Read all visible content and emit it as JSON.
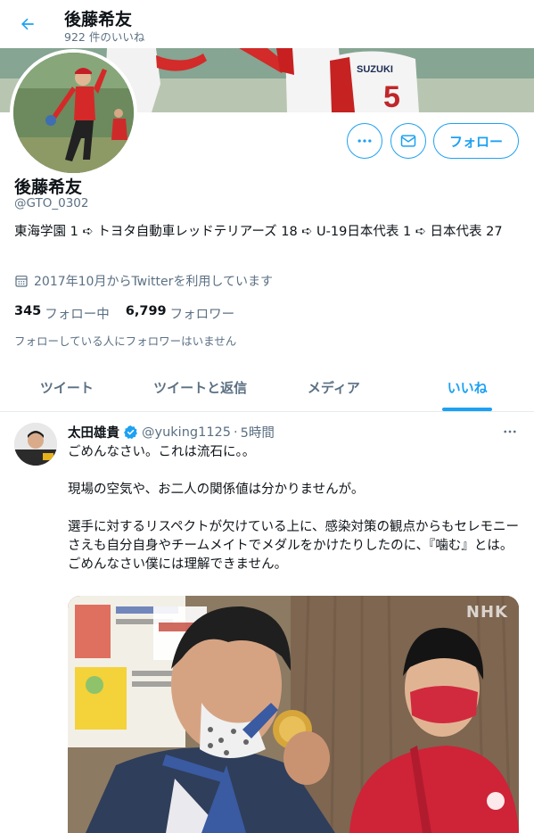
{
  "header": {
    "name": "後藤希友",
    "likes_count": "922 件のいいね",
    "back_icon": "arrow-left-icon"
  },
  "profile": {
    "display_name": "後藤希友",
    "handle": "@GTO_0302",
    "bio": "東海学園 1 ➪ トヨタ自動車レッドテリアーズ 18 ➪ U-19日本代表 1 ➪ 日本代表 27",
    "joined": "2017年10月からTwitterを利用しています",
    "following_count": "345",
    "following_label": "フォロー中",
    "followers_count": "6,799",
    "followers_label": "フォロワー",
    "known_followers": "フォローしている人にフォロワーはいません",
    "banner_jersey_text": "SUZUKI",
    "banner_jersey_number": "5"
  },
  "actions": {
    "more_icon": "ellipsis-icon",
    "message_icon": "envelope-icon",
    "follow_label": "フォロー"
  },
  "tabs": [
    {
      "label": "ツイート",
      "active": false
    },
    {
      "label": "ツイートと返信",
      "active": false
    },
    {
      "label": "メディア",
      "active": false
    },
    {
      "label": "いいね",
      "active": true
    }
  ],
  "tweet": {
    "author": "太田雄貴",
    "handle": "@yuking1125",
    "separator": "·",
    "time": "5時間",
    "lines": [
      "ごめんなさい。これは流石に。。",
      "",
      "現場の空気や、お二人の関係値は分かりませんが。",
      "",
      "選手に対するリスペクトが欠けている上に、感染対策の観点からもセレモニーさえも自分自身やチームメイトでメダルをかけたりしたのに、『噛む』とは。",
      "ごめんなさい僕には理解できません。"
    ],
    "media_watermark": "NHK"
  },
  "colors": {
    "accent": "#1da1f2",
    "text": "#0f1419",
    "secondary": "#5b7083",
    "border": "#e6ecf0"
  }
}
